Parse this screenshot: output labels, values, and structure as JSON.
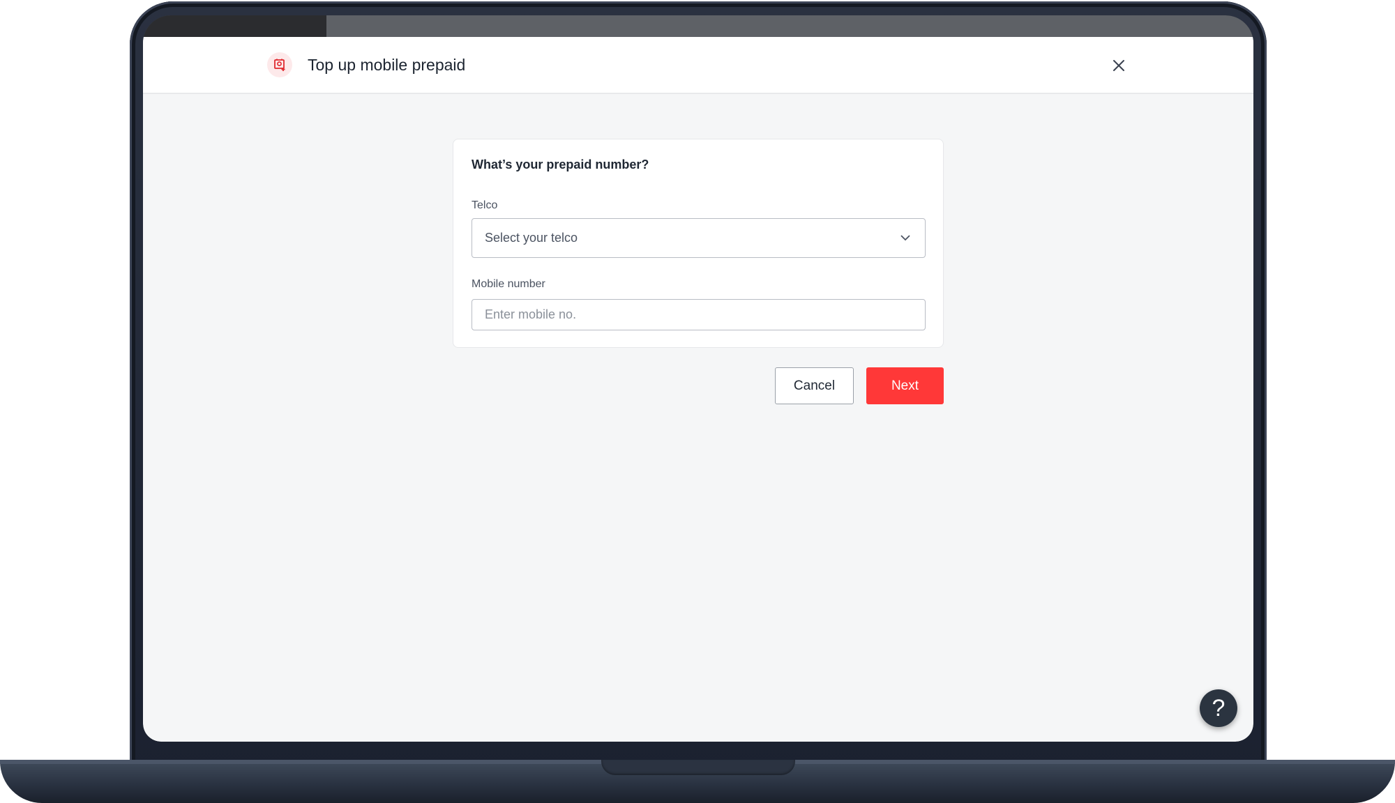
{
  "header": {
    "title": "Top up mobile prepaid",
    "icon": "mobile-topup-icon",
    "close_icon": "close-icon"
  },
  "form": {
    "question": "What’s your prepaid number?",
    "telco": {
      "label": "Telco",
      "placeholder": "Select your telco"
    },
    "mobile": {
      "label": "Mobile number",
      "placeholder": "Enter mobile no.",
      "value": ""
    }
  },
  "actions": {
    "cancel_label": "Cancel",
    "next_label": "Next"
  },
  "help": {
    "label": "?"
  },
  "colors": {
    "accent": "#ff3838",
    "icon_bg": "#fde9ea",
    "page_bg": "#f5f6f7",
    "help_bg": "#2b3440"
  }
}
